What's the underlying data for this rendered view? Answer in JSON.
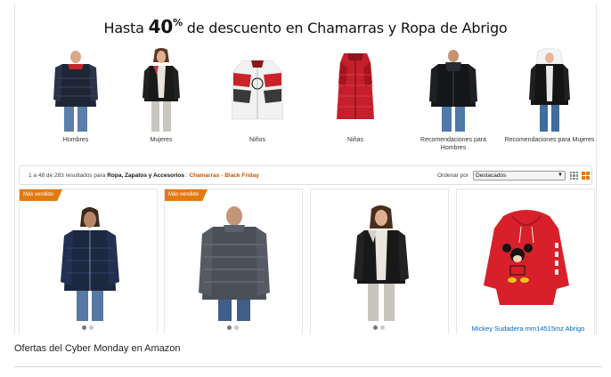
{
  "banner": {
    "prefix": "Hasta",
    "percent": "40",
    "percent_sign": "%",
    "suffix": "de descuento en Chamarras y Ropa de Abrigo"
  },
  "categories": [
    {
      "label": "Hombres",
      "icon": "mens-puffer-jacket-image"
    },
    {
      "label": "Mujeres",
      "icon": "womens-leather-jacket-image"
    },
    {
      "label": "Niños",
      "icon": "kids-avengers-jacket-image"
    },
    {
      "label": "Niñas",
      "icon": "girls-red-vest-image"
    },
    {
      "label": "Recomendaciones para Hombres",
      "icon": "mens-black-jacket-image"
    },
    {
      "label": "Recomendaciones para Mujeres",
      "icon": "womens-black-parka-image"
    }
  ],
  "results": {
    "count_text": "1 a 48 de 283 resultados para",
    "category_path": "Ropa, Zapatos y Accesorios",
    "separator": ":",
    "highlight": "Chamarras - Black Friday",
    "sort_label": "Ordenar por",
    "sort_value": "Destacados"
  },
  "products": [
    {
      "badge": "Más vendido",
      "title": ""
    },
    {
      "badge": "Más vendido",
      "title": ""
    },
    {
      "badge": "",
      "title": ""
    },
    {
      "badge": "",
      "title": "Mickey Sudadera mm14515mz Abrigo"
    }
  ],
  "caption": "Ofertas del Cyber Monday en Amazon",
  "colors": {
    "accent_orange": "#e47911",
    "link_blue": "#0066c0",
    "highlight_text": "#c45500"
  }
}
